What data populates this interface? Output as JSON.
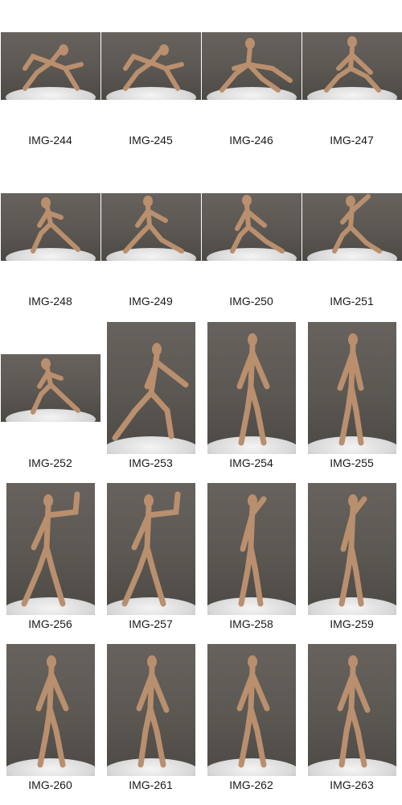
{
  "gallery": {
    "items": [
      {
        "caption": "IMG-244",
        "orientation": "landscape",
        "pose": "crouch-arch"
      },
      {
        "caption": "IMG-245",
        "orientation": "landscape",
        "pose": "crouch-arch"
      },
      {
        "caption": "IMG-246",
        "orientation": "landscape",
        "pose": "crouch-reach"
      },
      {
        "caption": "IMG-247",
        "orientation": "landscape",
        "pose": "crouch-back"
      },
      {
        "caption": "IMG-248",
        "orientation": "landscape",
        "pose": "kneel-side"
      },
      {
        "caption": "IMG-249",
        "orientation": "landscape",
        "pose": "kneel-front"
      },
      {
        "caption": "IMG-250",
        "orientation": "landscape",
        "pose": "kneel-back"
      },
      {
        "caption": "IMG-251",
        "orientation": "landscape",
        "pose": "kneel-reach"
      },
      {
        "caption": "IMG-252",
        "orientation": "landscape",
        "pose": "kneel-side"
      },
      {
        "caption": "IMG-253",
        "orientation": "portrait",
        "pose": "lunge"
      },
      {
        "caption": "IMG-254",
        "orientation": "portrait",
        "pose": "stand-back"
      },
      {
        "caption": "IMG-255",
        "orientation": "portrait",
        "pose": "stand-side"
      },
      {
        "caption": "IMG-256",
        "orientation": "portrait",
        "pose": "stand-raise"
      },
      {
        "caption": "IMG-257",
        "orientation": "portrait",
        "pose": "stand-raise"
      },
      {
        "caption": "IMG-258",
        "orientation": "portrait",
        "pose": "stand-turn"
      },
      {
        "caption": "IMG-259",
        "orientation": "portrait",
        "pose": "stand-turn"
      },
      {
        "caption": "IMG-260",
        "orientation": "portrait",
        "pose": "stand-back"
      },
      {
        "caption": "IMG-261",
        "orientation": "portrait",
        "pose": "stand-front"
      },
      {
        "caption": "IMG-262",
        "orientation": "portrait",
        "pose": "stand-back"
      },
      {
        "caption": "IMG-263",
        "orientation": "portrait",
        "pose": "stand-front"
      }
    ]
  },
  "colors": {
    "background": "#ffffff",
    "studio": "#5b5752",
    "skin": "#b98f6e",
    "caption": "#1a1a1a"
  }
}
